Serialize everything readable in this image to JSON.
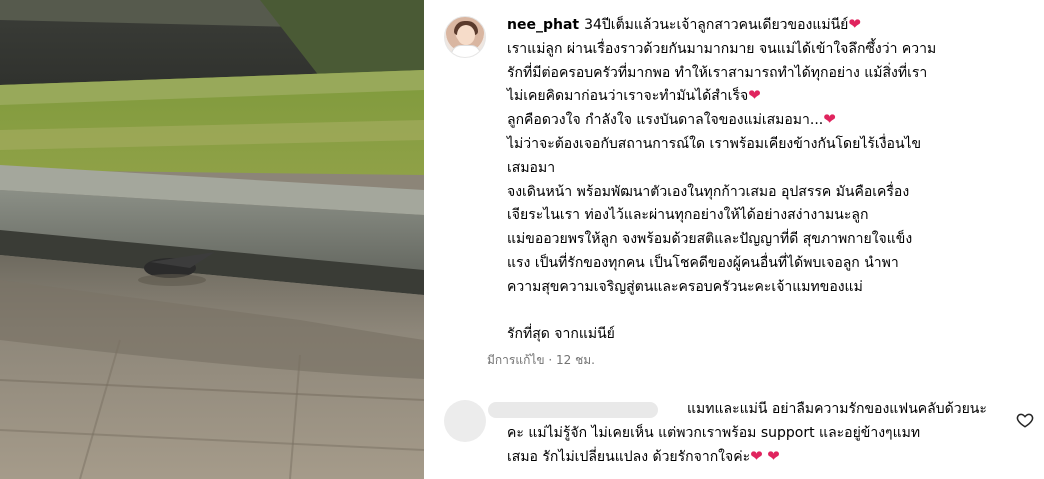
{
  "post": {
    "username": "nee_phat",
    "caption_lines": [
      "34ปีเต็มแล้วนะเจ้าลูกสาวคนเดียวของแม่นีย์",
      "เราแม่ลูก ผ่านเรื่องราวด้วยกันมามากมาย จนแม่ได้เข้าใจลึกซึ้งว่า ความ",
      "รักที่มีต่อครอบครัวที่มากพอ ทำให้เราสามารถทำได้ทุกอย่าง แม้สิ่งที่เรา",
      "ไม่เคยคิดมาก่อนว่าเราจะทำมันได้สำเร็จ",
      "ลูกคือดวงใจ กำลังใจ แรงบันดาลใจของแม่เสมอมา...",
      "ไม่ว่าจะต้องเจอกับสถานการณ์ใด เราพร้อมเคียงข้างกันโดยไร้เงื่อนไข",
      "เสมอมา",
      "จงเดินหน้า พร้อมพัฒนาตัวเองในทุกก้าวเสมอ อุปสรรค มันคือเครื่อง",
      "เจียระไนเรา ท่องไว้และผ่านทุกอย่างให้ได้อย่างสง่างามนะลูก",
      "แม่ขออวยพรให้ลูก จงพร้อมด้วยสติและปัญญาที่ดี สุขภาพกายใจแข็ง",
      "แรง เป็นที่รักของทุกคน เป็นโชคดีของผู้คนอื่นที่ได้พบเจอลูก นำพา",
      "ความสุขความเจริญสู่ตนและครอบครัวนะคะเจ้าแมทของแม่",
      "",
      "รักที่สุด จากแม่นีย์"
    ],
    "meta": "มีการแก้ไข · 12 ชม."
  },
  "comment": {
    "text_lines": [
      "แมทและแม่นี อย่าลืมความรักของแฟนคลับด้วยนะ",
      "คะ แม่ไม่รู้จัก ไม่เคยเห็น แต่พวกเราพร้อม support และอยู่ข้างๆแมท",
      "เสมอ รักไม่เปลี่ยนแปลง ด้วยรักจากใจค่ะ"
    ]
  },
  "icons": {
    "heart": "red-heart-emoji",
    "like": "heart-outline-icon"
  },
  "colors": {
    "heart": "#e0245e",
    "meta_text": "#737373",
    "blurred_username": "#e9e9e9"
  },
  "glyphs": {
    "heart": "❤"
  }
}
